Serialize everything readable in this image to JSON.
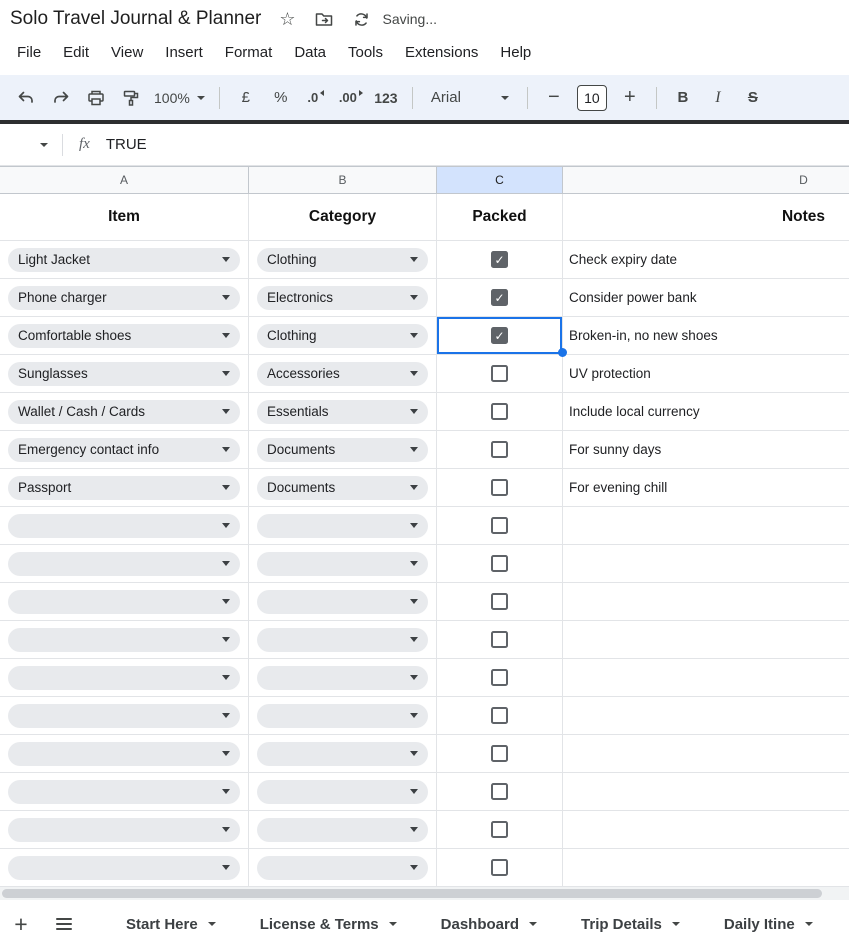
{
  "titlebar": {
    "title": "Solo Travel Journal & Planner",
    "saving_status": "Saving..."
  },
  "menubar": {
    "items": [
      "File",
      "Edit",
      "View",
      "Insert",
      "Format",
      "Data",
      "Tools",
      "Extensions",
      "Help"
    ]
  },
  "toolbar": {
    "zoom": "100%",
    "currency_label": "£",
    "percent_label": "%",
    "decrease_decimal_label": ".0",
    "increase_decimal_label": ".00",
    "number_format_label": "123",
    "font_family": "Arial",
    "minus_label": "−",
    "font_size": "10",
    "plus_label": "+",
    "bold_label": "B",
    "italic_label": "I",
    "strikethrough_label": "S"
  },
  "formula_bar": {
    "fx_label": "fx",
    "value": "TRUE"
  },
  "grid": {
    "columns": [
      {
        "letter": "A",
        "header": "Item"
      },
      {
        "letter": "B",
        "header": "Category"
      },
      {
        "letter": "C",
        "header": "Packed",
        "selected": true
      },
      {
        "letter": "D",
        "header": "Notes"
      }
    ],
    "rows": [
      {
        "item": "Light Jacket",
        "category": "Clothing",
        "packed": true,
        "selected": false,
        "notes": "Check expiry date"
      },
      {
        "item": "Phone charger",
        "category": "Electronics",
        "packed": true,
        "selected": false,
        "notes": "Consider power bank"
      },
      {
        "item": "Comfortable shoes",
        "category": "Clothing",
        "packed": true,
        "selected": true,
        "notes": "Broken-in, no new shoes"
      },
      {
        "item": "Sunglasses",
        "category": "Accessories",
        "packed": false,
        "selected": false,
        "notes": "UV protection"
      },
      {
        "item": "Wallet / Cash / Cards",
        "category": "Essentials",
        "packed": false,
        "selected": false,
        "notes": "Include local currency"
      },
      {
        "item": "Emergency contact info",
        "category": "Documents",
        "packed": false,
        "selected": false,
        "notes": "For sunny days"
      },
      {
        "item": "Passport",
        "category": "Documents",
        "packed": false,
        "selected": false,
        "notes": "For evening chill"
      },
      {
        "item": "",
        "category": "",
        "packed": false,
        "selected": false,
        "notes": ""
      },
      {
        "item": "",
        "category": "",
        "packed": false,
        "selected": false,
        "notes": ""
      },
      {
        "item": "",
        "category": "",
        "packed": false,
        "selected": false,
        "notes": ""
      },
      {
        "item": "",
        "category": "",
        "packed": false,
        "selected": false,
        "notes": ""
      },
      {
        "item": "",
        "category": "",
        "packed": false,
        "selected": false,
        "notes": ""
      },
      {
        "item": "",
        "category": "",
        "packed": false,
        "selected": false,
        "notes": ""
      },
      {
        "item": "",
        "category": "",
        "packed": false,
        "selected": false,
        "notes": ""
      },
      {
        "item": "",
        "category": "",
        "packed": false,
        "selected": false,
        "notes": ""
      },
      {
        "item": "",
        "category": "",
        "packed": false,
        "selected": false,
        "notes": ""
      },
      {
        "item": "",
        "category": "",
        "packed": false,
        "selected": false,
        "notes": ""
      }
    ]
  },
  "sheetbar": {
    "tabs": [
      "Start Here",
      "License & Terms",
      "Dashboard",
      "Trip Details",
      "Daily Itine"
    ]
  },
  "colors": {
    "accent": "#1a73e8",
    "selected_column_header_bg": "#d3e3fd",
    "checkbox_checked": "#5f6368",
    "toolbar_bg": "#edf2fa"
  }
}
